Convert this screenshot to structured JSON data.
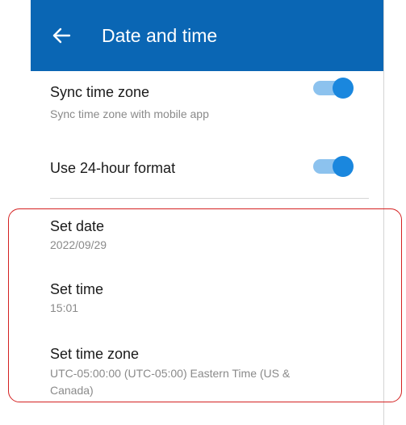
{
  "appbar": {
    "title": "Date and time",
    "back_icon": "arrow-left-icon",
    "color": "#0A66B4"
  },
  "settings": {
    "sync_time_zone": {
      "label": "Sync time zone",
      "description": "Sync time zone with mobile app",
      "enabled": true
    },
    "use_24_hour": {
      "label": "Use 24-hour format",
      "enabled": true
    },
    "set_date": {
      "label": "Set date",
      "value": "2022/09/29"
    },
    "set_time": {
      "label": "Set time",
      "value": "15:01"
    },
    "set_time_zone": {
      "label": "Set time zone",
      "value_line1": "UTC-05:00:00 (UTC-05:00) Eastern Time (US &",
      "value_line2": "Canada)"
    }
  },
  "colors": {
    "toggle_on_track": "#8cc2ee",
    "toggle_on_thumb": "#1a87de",
    "highlight_border": "#d42121"
  }
}
